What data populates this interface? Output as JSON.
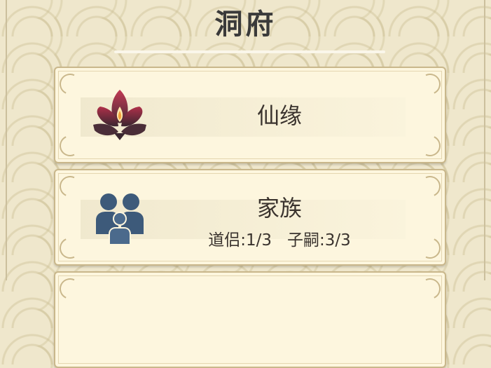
{
  "page": {
    "title": "洞府"
  },
  "cards": [
    {
      "title": "仙缘",
      "icon": "lotus-icon"
    },
    {
      "title": "家族",
      "icon": "family-icon",
      "stats": [
        {
          "label": "道侣:1/3"
        },
        {
          "label": "子嗣:3/3"
        }
      ]
    }
  ],
  "colors": {
    "background": "#efe7cc",
    "card": "#fdf6de",
    "card_border": "#c9b78b",
    "lotus": "#b0304a",
    "family": "#3d5a7a",
    "text": "#3a332e"
  }
}
